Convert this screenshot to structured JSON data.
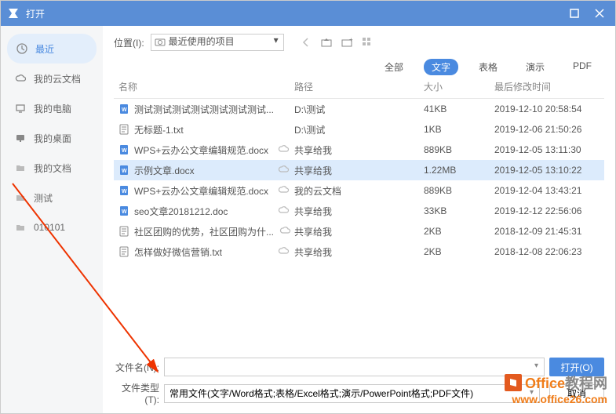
{
  "window": {
    "title": "打开"
  },
  "sidebar": {
    "items": [
      {
        "label": "最近",
        "icon": "clock"
      },
      {
        "label": "我的云文档",
        "icon": "cloud"
      },
      {
        "label": "我的电脑",
        "icon": "computer"
      },
      {
        "label": "我的桌面",
        "icon": "desktop"
      },
      {
        "label": "我的文档",
        "icon": "folder"
      },
      {
        "label": "测试",
        "icon": "folder"
      },
      {
        "label": "010101",
        "icon": "folder"
      }
    ]
  },
  "toolbar": {
    "loc_label": "位置(I):",
    "loc_value": "最近使用的项目"
  },
  "filters": {
    "items": [
      {
        "label": "全部"
      },
      {
        "label": "文字"
      },
      {
        "label": "表格"
      },
      {
        "label": "演示"
      },
      {
        "label": "PDF"
      }
    ],
    "active_index": 1
  },
  "columns": {
    "name": "名称",
    "path": "路径",
    "size": "大小",
    "date": "最后修改时间"
  },
  "files": [
    {
      "name": "测试测试测试测试测试测试测试...",
      "path": "D:\\测试",
      "size": "41KB",
      "date": "2019-12-10 20:58:54",
      "icon": "doc-w",
      "cloud": false,
      "selected": false
    },
    {
      "name": "无标题-1.txt",
      "path": "D:\\测试",
      "size": "1KB",
      "date": "2019-12-06 21:50:26",
      "icon": "txt",
      "cloud": false,
      "selected": false
    },
    {
      "name": "WPS+云办公文章编辑规范.docx",
      "path": "共享给我",
      "size": "889KB",
      "date": "2019-12-05 13:11:30",
      "icon": "doc-w",
      "cloud": true,
      "selected": false
    },
    {
      "name": "示例文章.docx",
      "path": "共享给我",
      "size": "1.22MB",
      "date": "2019-12-05 13:10:22",
      "icon": "doc-w",
      "cloud": true,
      "selected": true
    },
    {
      "name": "WPS+云办公文章编辑规范.docx",
      "path": "我的云文档",
      "size": "889KB",
      "date": "2019-12-04 13:43:21",
      "icon": "doc-w",
      "cloud": true,
      "selected": false
    },
    {
      "name": "seo文章20181212.doc",
      "path": "共享给我",
      "size": "33KB",
      "date": "2019-12-12 22:56:06",
      "icon": "doc-w",
      "cloud": true,
      "selected": false
    },
    {
      "name": "社区团购的优势，社区团购为什...",
      "path": "共享给我",
      "size": "2KB",
      "date": "2018-12-09 21:45:31",
      "icon": "txt",
      "cloud": true,
      "selected": false
    },
    {
      "name": "怎样做好微信营销.txt",
      "path": "共享给我",
      "size": "2KB",
      "date": "2018-12-08 22:06:23",
      "icon": "txt",
      "cloud": true,
      "selected": false
    }
  ],
  "inputs": {
    "filename_label": "文件名(N):",
    "filename_value": "",
    "filetype_label": "文件类型(T):",
    "filetype_value": "常用文件(文字/Word格式;表格/Excel格式;演示/PowerPoint格式;PDF文件)",
    "open_btn": "打开(O)",
    "cancel_btn": "取消"
  },
  "watermark": {
    "brand1": "Office",
    "brand2": "教程网",
    "url": "www.office26.com"
  }
}
